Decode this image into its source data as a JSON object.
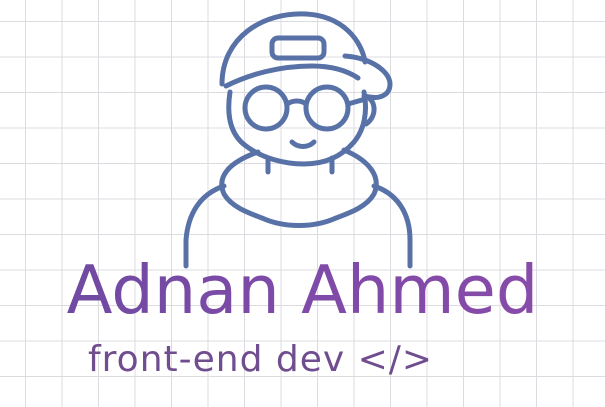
{
  "logo": {
    "name": "Adnan Ahmed",
    "tagline": "front-end dev </>",
    "colors": {
      "purple": "#6a2f7c",
      "slate": "#5c6fa8",
      "grid": "#dcdce0",
      "background": "#ffffff"
    },
    "icon": "developer-avatar-with-cap-and-glasses"
  }
}
